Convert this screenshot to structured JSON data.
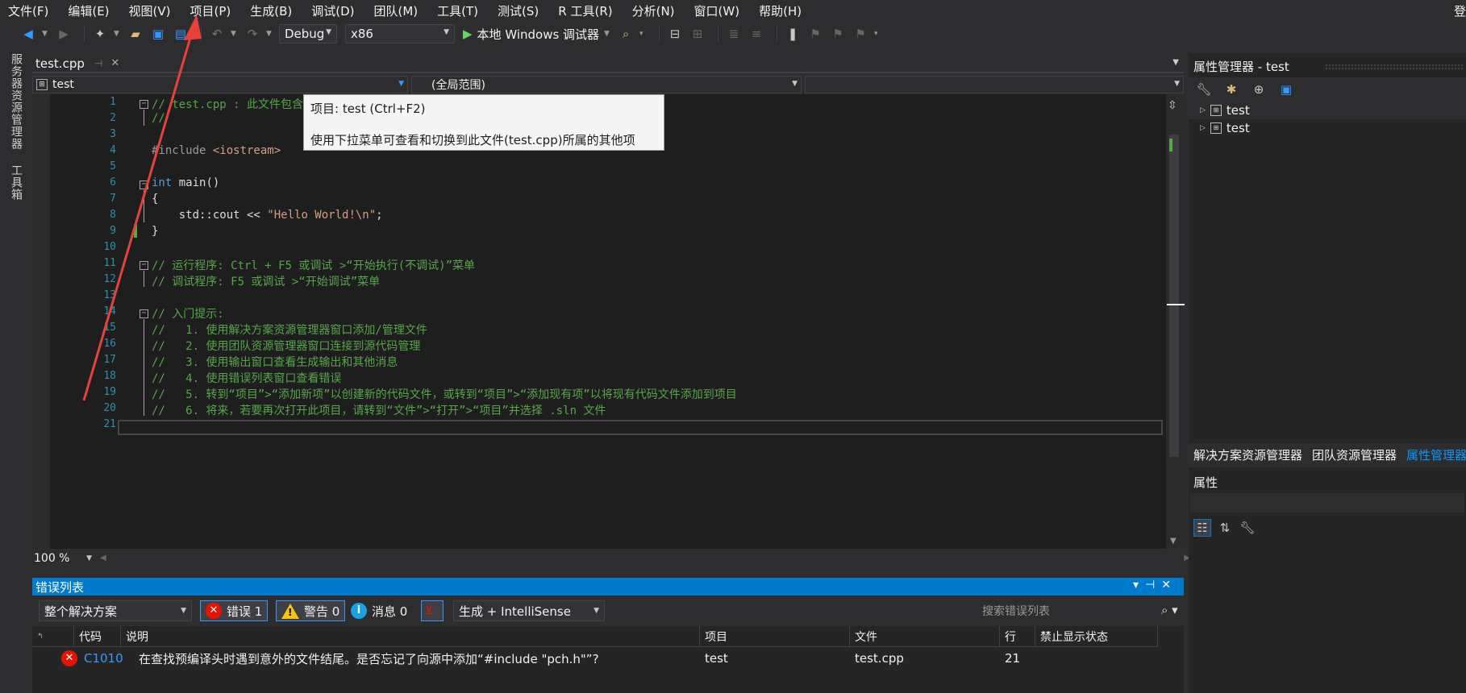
{
  "menu": {
    "items": [
      "文件(F)",
      "编辑(E)",
      "视图(V)",
      "项目(P)",
      "生成(B)",
      "调试(D)",
      "团队(M)",
      "工具(T)",
      "测试(S)",
      "R 工具(R)",
      "分析(N)",
      "窗口(W)",
      "帮助(H)"
    ],
    "right_label": "登"
  },
  "toolbar": {
    "config": "Debug",
    "platform": "x86",
    "run_label": "本地 Windows 调试器"
  },
  "left_tabs": {
    "server_explorer": "服务器资源管理器",
    "toolbox": "工具箱"
  },
  "editor": {
    "tab_title": "test.cpp",
    "nav_project": "test",
    "nav_scope": "(全局范围)",
    "nav_member": "",
    "zoom": "100 %",
    "line_numbers": [
      "1",
      "2",
      "3",
      "4",
      "5",
      "6",
      "7",
      "8",
      "9",
      "10",
      "11",
      "12",
      "13",
      "14",
      "15",
      "16",
      "17",
      "18",
      "19",
      "20",
      "21"
    ],
    "lines": {
      "l1": "// test.cpp : 此文件包含 \"main\" 函数。程序执行将在此处开始并结束。",
      "l2": "//",
      "l4a": "#include ",
      "l4b": "<iostream>",
      "l6a": "int",
      "l6b": " main()",
      "l7": "{",
      "l8a": "    std::cout << ",
      "l8b": "\"Hello World!\\n\"",
      "l8c": ";",
      "l9": "}",
      "l11": "// 运行程序: Ctrl + F5 或调试 >“开始执行(不调试)”菜单",
      "l12": "// 调试程序: F5 或调试 >“开始调试”菜单",
      "l14": "// 入门提示:",
      "l15": "//   1. 使用解决方案资源管理器窗口添加/管理文件",
      "l16": "//   2. 使用团队资源管理器窗口连接到源代码管理",
      "l17": "//   3. 使用输出窗口查看生成输出和其他消息",
      "l18": "//   4. 使用错误列表窗口查看错误",
      "l19": "//   5. 转到“项目”>“添加新项”以创建新的代码文件，或转到“项目”>“添加现有项”以将现有代码文件添加到项目",
      "l20": "//   6. 将来，若要再次打开此项目，请转到“文件”>“打开”>“项目”并选择 .sln 文件"
    }
  },
  "tooltip": {
    "title": "项目: test (Ctrl+F2)",
    "body": "使用下拉菜单可查看和切换到此文件(test.cpp)所属的其他项目。"
  },
  "property_manager": {
    "title": "属性管理器 - test",
    "items": [
      "test",
      "test"
    ]
  },
  "right_tabs": [
    "解决方案资源管理器",
    "团队资源管理器",
    "属性管理器"
  ],
  "properties": {
    "title": "属性"
  },
  "error_list": {
    "title": "错误列表",
    "scope": "整个解决方案",
    "errors_label": "错误 1",
    "warnings_label": "警告 0",
    "messages_label": "消息 0",
    "build_filter": "生成 + IntelliSense",
    "search_placeholder": "搜索错误列表",
    "columns": [
      "代码",
      "说明",
      "项目",
      "文件",
      "行",
      "禁止显示状态"
    ],
    "rows": [
      {
        "code": "C1010",
        "desc": "在查找预编译头时遇到意外的文件结尾。是否忘记了向源中添加“#include \"pch.h\"”?",
        "project": "test",
        "file": "test.cpp",
        "line": "21",
        "suppress": ""
      }
    ]
  },
  "colors": {
    "accent": "#007acc",
    "annotation_arrow": "#e8413a"
  }
}
